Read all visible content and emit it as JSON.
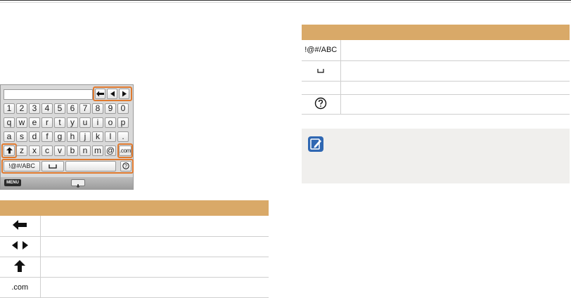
{
  "keyboard": {
    "row_numbers": [
      "1",
      "2",
      "3",
      "4",
      "5",
      "6",
      "7",
      "8",
      "9",
      "0"
    ],
    "row_top": [
      "q",
      "w",
      "e",
      "r",
      "t",
      "y",
      "u",
      "i",
      "o",
      "p"
    ],
    "row_middle": [
      "a",
      "s",
      "d",
      "f",
      "g",
      "h",
      "j",
      "k",
      "l",
      "."
    ],
    "row_bottom": [
      "z",
      "x",
      "c",
      "v",
      "b",
      "n",
      "m",
      "@",
      ".com"
    ],
    "symbols_key": "!@#/ABC",
    "menu_label": "MENU",
    "help_label": "?",
    "highlight_color": "#e07a2f",
    "icons": [
      "backspace-icon",
      "cursor-left-icon",
      "cursor-right-icon",
      "shift-icon",
      "space-icon",
      "help-icon",
      "microphone-icon"
    ]
  },
  "left_table": {
    "header_color": "#d9a968",
    "rows": [
      {
        "icon": "backspace-icon"
      },
      {
        "icon": "cursor-left-right-icon"
      },
      {
        "icon": "shift-icon"
      },
      {
        "label": ".com"
      }
    ]
  },
  "right_table": {
    "rows": [
      {
        "label": "!@#/ABC"
      },
      {
        "icon": "space-icon"
      },
      {
        "icon": "empty"
      },
      {
        "icon": "help-circle-icon"
      }
    ]
  },
  "note": {
    "icon": "note-pencil-icon",
    "background": "#f0efed",
    "icon_color": "#2f67b2"
  }
}
